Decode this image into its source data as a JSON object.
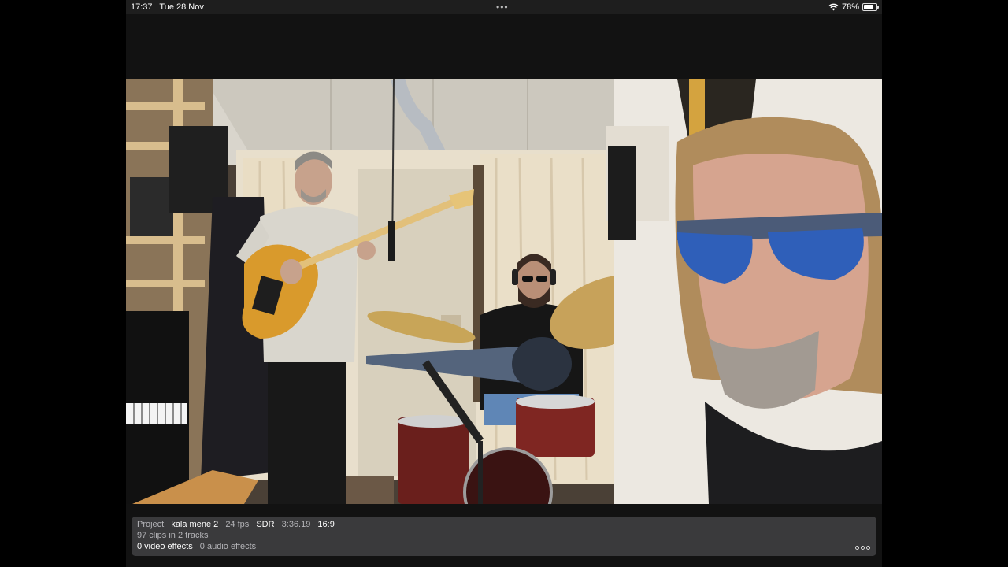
{
  "status_bar": {
    "time": "17:37",
    "date": "Tue 28 Nov",
    "multitask_icon": "ellipsis-dots",
    "wifi_icon": "wifi-icon",
    "battery": "78%",
    "battery_level": 0.78
  },
  "viewer": {
    "scene_description_icon": "video-frame"
  },
  "project_info": {
    "label": "Project",
    "name": "kala mene 2",
    "fps": "24 fps",
    "range": "SDR",
    "duration": "3:36.19",
    "aspect": "16:9",
    "clips": "97 clips in 2 tracks",
    "video_effects": "0 video effects",
    "audio_effects": "0 audio effects",
    "more_icon": "more-options-icon"
  }
}
